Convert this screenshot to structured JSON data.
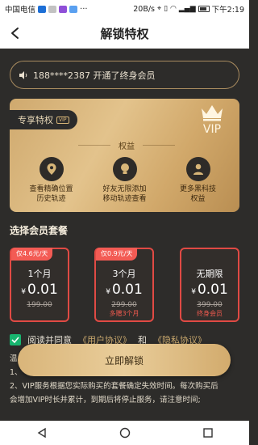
{
  "status_bar": {
    "carrier": "中国电信",
    "speed": "20B/s",
    "battery": "",
    "time": "下午2:19"
  },
  "header": {
    "title": "解锁特权"
  },
  "notice": {
    "text": "188****2387 开通了终身会员",
    "icon": "speaker-icon"
  },
  "privilege": {
    "tag": "专享特权",
    "tag_badge": "VIP",
    "vip_label": "VIP",
    "section_label": "权益",
    "items": [
      {
        "icon": "location-icon",
        "line1": "查看精确位置",
        "line2": "历史轨迹"
      },
      {
        "icon": "lightbulb-icon",
        "line1": "好友无限添加",
        "line2": "移动轨迹查看"
      },
      {
        "icon": "user-icon",
        "line1": "更多黑科技",
        "line2": "权益"
      }
    ]
  },
  "packages": {
    "title": "选择会员套餐",
    "items": [
      {
        "badge": "仅4.6元/天",
        "name": "1个月",
        "currency": "¥",
        "price": "0.01",
        "old_price": "199.00",
        "note": ""
      },
      {
        "badge": "仅0.9元/天",
        "name": "3个月",
        "currency": "¥",
        "price": "0.01",
        "old_price": "299.00",
        "note": "多赠3个月"
      },
      {
        "badge": "",
        "name": "无期限",
        "currency": "¥",
        "price": "0.01",
        "old_price": "399.00",
        "note": "终身会员"
      }
    ]
  },
  "agreement": {
    "prefix": "阅读并同意",
    "user_link": "《用户协议》",
    "and": "和",
    "privacy_link": "《隐私协议》"
  },
  "tips": {
    "line0": "温",
    "line1": "1、",
    "line2": "2、VIP服务根据您实际购买的套餐确定失效时间。每次购买后",
    "line3": "会增加VIP时长并累计，到期后将停止服务，请注意时间;"
  },
  "cta": {
    "label": "立即解锁"
  },
  "colors": {
    "accent_red": "#e04a44",
    "gold": "#d9b57a",
    "dark_bg": "#2d2c2a"
  }
}
